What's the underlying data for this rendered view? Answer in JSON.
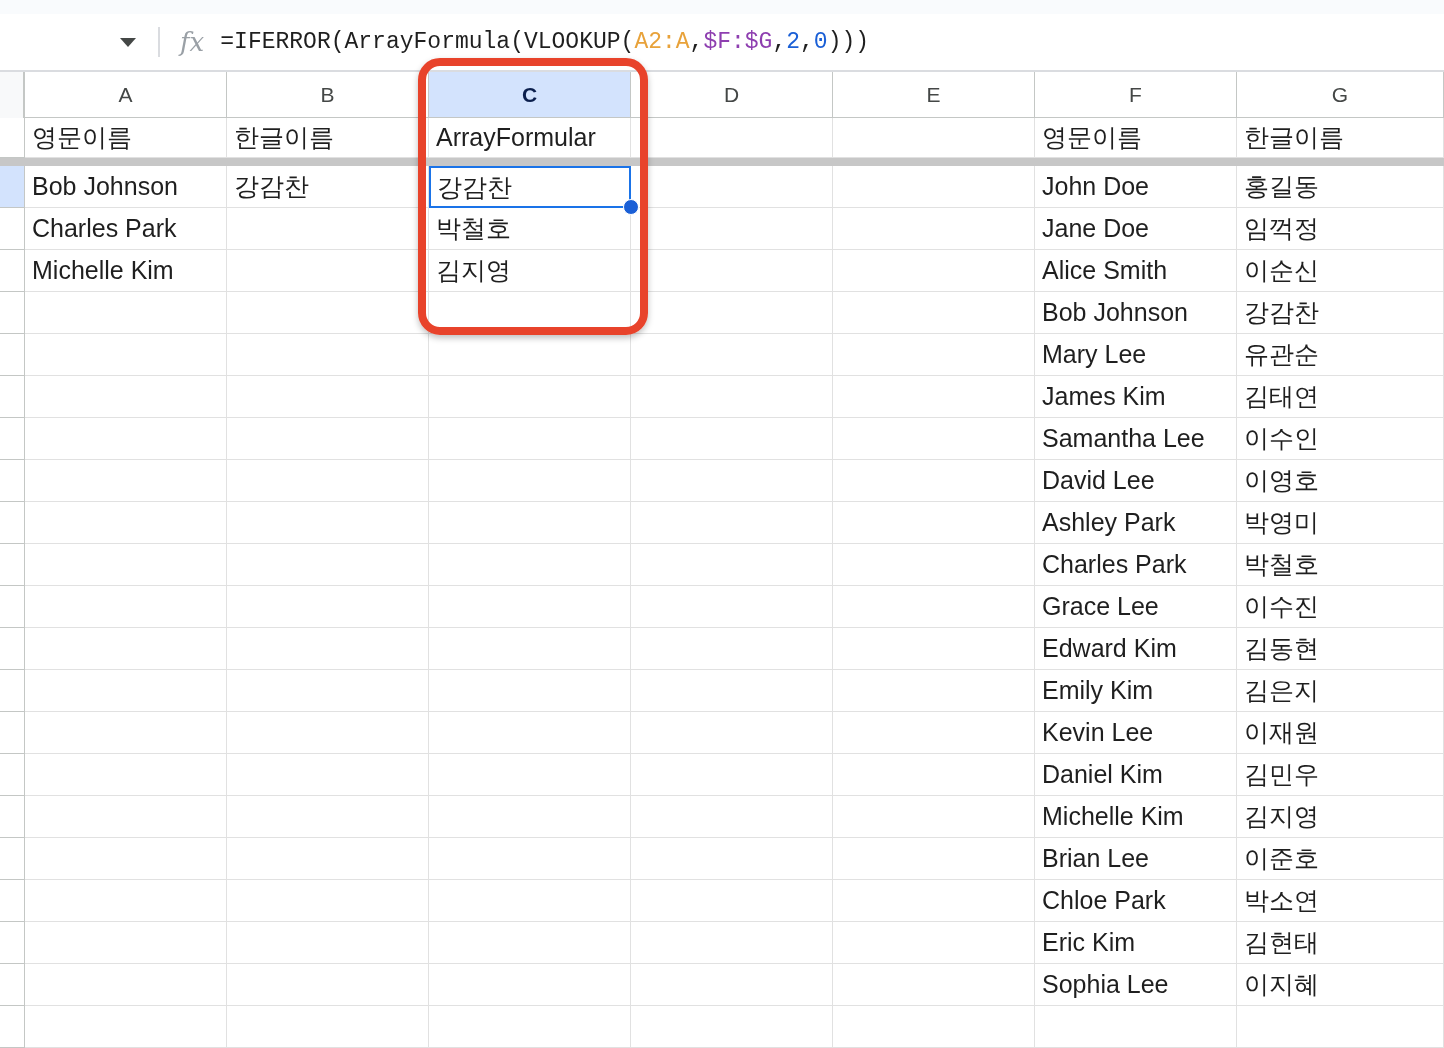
{
  "formula_bar": {
    "icon_text": "fx",
    "segments": [
      {
        "text": "=IFERROR(ArrayFormula(VLOOKUP(",
        "color": "#1f1f1f"
      },
      {
        "text": "A2:A",
        "color": "#e8a23a"
      },
      {
        "text": ",",
        "color": "#1f1f1f"
      },
      {
        "text": "$F:$G",
        "color": "#8e3fb0"
      },
      {
        "text": ",",
        "color": "#1f1f1f"
      },
      {
        "text": "2",
        "color": "#1a5fd6"
      },
      {
        "text": ",",
        "color": "#1f1f1f"
      },
      {
        "text": "0",
        "color": "#1a5fd6"
      },
      {
        "text": ")))",
        "color": "#1f1f1f"
      }
    ]
  },
  "columns": [
    {
      "label": "A",
      "selected": false
    },
    {
      "label": "B",
      "selected": false
    },
    {
      "label": "C",
      "selected": true
    },
    {
      "label": "D",
      "selected": false
    },
    {
      "label": "E",
      "selected": false
    },
    {
      "label": "F",
      "selected": false
    },
    {
      "label": "G",
      "selected": false
    }
  ],
  "header_row": {
    "col_a": "영문이름",
    "col_b": "한글이름",
    "col_c": "ArrayFormular",
    "col_f": "영문이름",
    "col_g": "한글이름"
  },
  "rows": [
    {
      "selected": true,
      "col_a": "Bob Johnson",
      "col_b": "강감찬",
      "col_c": "강감찬",
      "col_f": "John Doe",
      "col_g": "홍길동"
    },
    {
      "selected": false,
      "col_a": "Charles Park",
      "col_c": "박철호",
      "col_f": "Jane Doe",
      "col_g": "임꺽정"
    },
    {
      "selected": false,
      "col_a": "Michelle Kim",
      "col_c": "김지영",
      "col_f": "Alice Smith",
      "col_g": "이순신"
    },
    {
      "selected": false,
      "col_f": "Bob Johnson",
      "col_g": "강감찬"
    },
    {
      "selected": false,
      "col_f": "Mary Lee",
      "col_g": "유관순"
    },
    {
      "selected": false,
      "col_f": "James Kim",
      "col_g": "김태연"
    },
    {
      "selected": false,
      "col_f": "Samantha Lee",
      "col_g": "이수인"
    },
    {
      "selected": false,
      "col_f": "David Lee",
      "col_g": "이영호"
    },
    {
      "selected": false,
      "col_f": "Ashley Park",
      "col_g": "박영미"
    },
    {
      "selected": false,
      "col_f": "Charles Park",
      "col_g": "박철호"
    },
    {
      "selected": false,
      "col_f": "Grace Lee",
      "col_g": "이수진"
    },
    {
      "selected": false,
      "col_f": "Edward Kim",
      "col_g": "김동현"
    },
    {
      "selected": false,
      "col_f": "Emily Kim",
      "col_g": "김은지"
    },
    {
      "selected": false,
      "col_f": "Kevin Lee",
      "col_g": "이재원"
    },
    {
      "selected": false,
      "col_f": "Daniel Kim",
      "col_g": "김민우"
    },
    {
      "selected": false,
      "col_f": "Michelle Kim",
      "col_g": "김지영"
    },
    {
      "selected": false,
      "col_f": "Brian Lee",
      "col_g": "이준호"
    },
    {
      "selected": false,
      "col_f": "Chloe Park",
      "col_g": "박소연"
    },
    {
      "selected": false,
      "col_f": "Eric Kim",
      "col_g": "김현태"
    },
    {
      "selected": false,
      "col_f": "Sophia Lee",
      "col_g": "이지혜"
    },
    {
      "selected": false
    }
  ]
}
